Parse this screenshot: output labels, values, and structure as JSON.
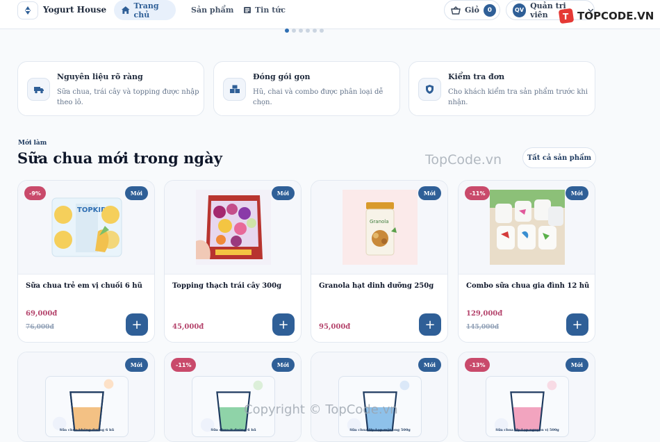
{
  "header": {
    "brand": "Yogurt House",
    "nav": {
      "home": "Trang chủ",
      "products": "Sản phẩm",
      "news": "Tin tức"
    },
    "cart": {
      "label": "Giỏ",
      "count": "0"
    },
    "user": {
      "initials": "QV",
      "name": "Quản trị viên"
    },
    "watermark": "TOPCODE.VN"
  },
  "carousel": {
    "dots": 6,
    "active": 0
  },
  "features": [
    {
      "title": "Nguyên liệu rõ ràng",
      "desc": "Sữa chua, trái cây và topping được nhập theo lô.",
      "icon": "truck-icon"
    },
    {
      "title": "Đóng gói gọn",
      "desc": "Hũ, chai và combo được phân loại dễ chọn.",
      "icon": "boxes-icon"
    },
    {
      "title": "Kiểm tra đơn",
      "desc": "Cho khách kiểm tra sản phẩm trước khi nhận.",
      "icon": "shield-icon"
    }
  ],
  "section": {
    "eyebrow": "Mới làm",
    "title": "Sữa chua mới trong ngày",
    "all_button": "Tất cả sản phẩm",
    "watermark": "TopCode.vn"
  },
  "products": [
    {
      "name": "Sữa chua trẻ em vị chuối 6 hũ",
      "price": "69,000đ",
      "old_price": "76,000đ",
      "discount": "-9%",
      "badge": "Mới",
      "add": "+"
    },
    {
      "name": "Topping thạch trái cây 300g",
      "price": "45,000đ",
      "old_price": "",
      "discount": "",
      "badge": "Mới",
      "add": "+"
    },
    {
      "name": "Granola hạt dinh dưỡng 250g",
      "price": "95,000đ",
      "old_price": "",
      "discount": "",
      "badge": "Mới",
      "add": "+"
    },
    {
      "name": "Combo sữa chua gia đình 12 hũ",
      "price": "129,000đ",
      "old_price": "145,000đ",
      "discount": "-11%",
      "badge": "Mới",
      "add": "+"
    }
  ],
  "products_row2": [
    {
      "discount": "",
      "badge": "Mới",
      "cup_label": "Sữa chua không đường 6 hũ",
      "color": "#f3c184"
    },
    {
      "discount": "-11%",
      "badge": "Mới",
      "cup_label": "Sữa chua ít đường 6 hũ",
      "color": "#8fd3a8"
    },
    {
      "discount": "",
      "badge": "Mới",
      "cup_label": "Sữa chua Hy Lạp mật ong 500g",
      "color": "#8ec1ea"
    },
    {
      "discount": "-13%",
      "badge": "Mới",
      "cup_label": "Sữa chua Hy Lạp nguyên vị 500g",
      "color": "#f2a4bf"
    }
  ],
  "footer_watermark": "Copyright © TopCode.vn"
}
